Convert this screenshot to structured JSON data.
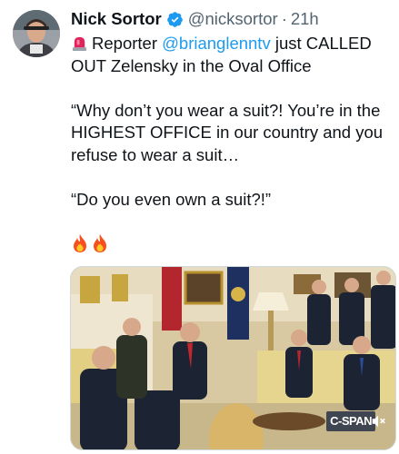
{
  "author": {
    "name": "Nick Sortor",
    "handle": "@nicksortor",
    "separator": "·",
    "time": "21h",
    "verified": true,
    "verified_color": "#1d9bf0"
  },
  "post": {
    "line1_prefix": "Reporter ",
    "mention": "@brianglenntv",
    "line1_suffix": " just CALLED OUT Zelensky in the Oval Office",
    "quote1": "“Why don’t you wear a suit?! You’re in the HIGHEST OFFICE in our country and you refuse to wear a suit…",
    "quote2": "“Do you even own a suit?!”",
    "emoji_icons": [
      "siren-icon",
      "fire-icon",
      "fire-icon"
    ]
  },
  "media": {
    "type": "video",
    "watermark": "C-SPAN",
    "icons": [
      "mute-icon"
    ]
  },
  "colors": {
    "text": "#0f1419",
    "secondary": "#536471",
    "link": "#1d9bf0"
  }
}
